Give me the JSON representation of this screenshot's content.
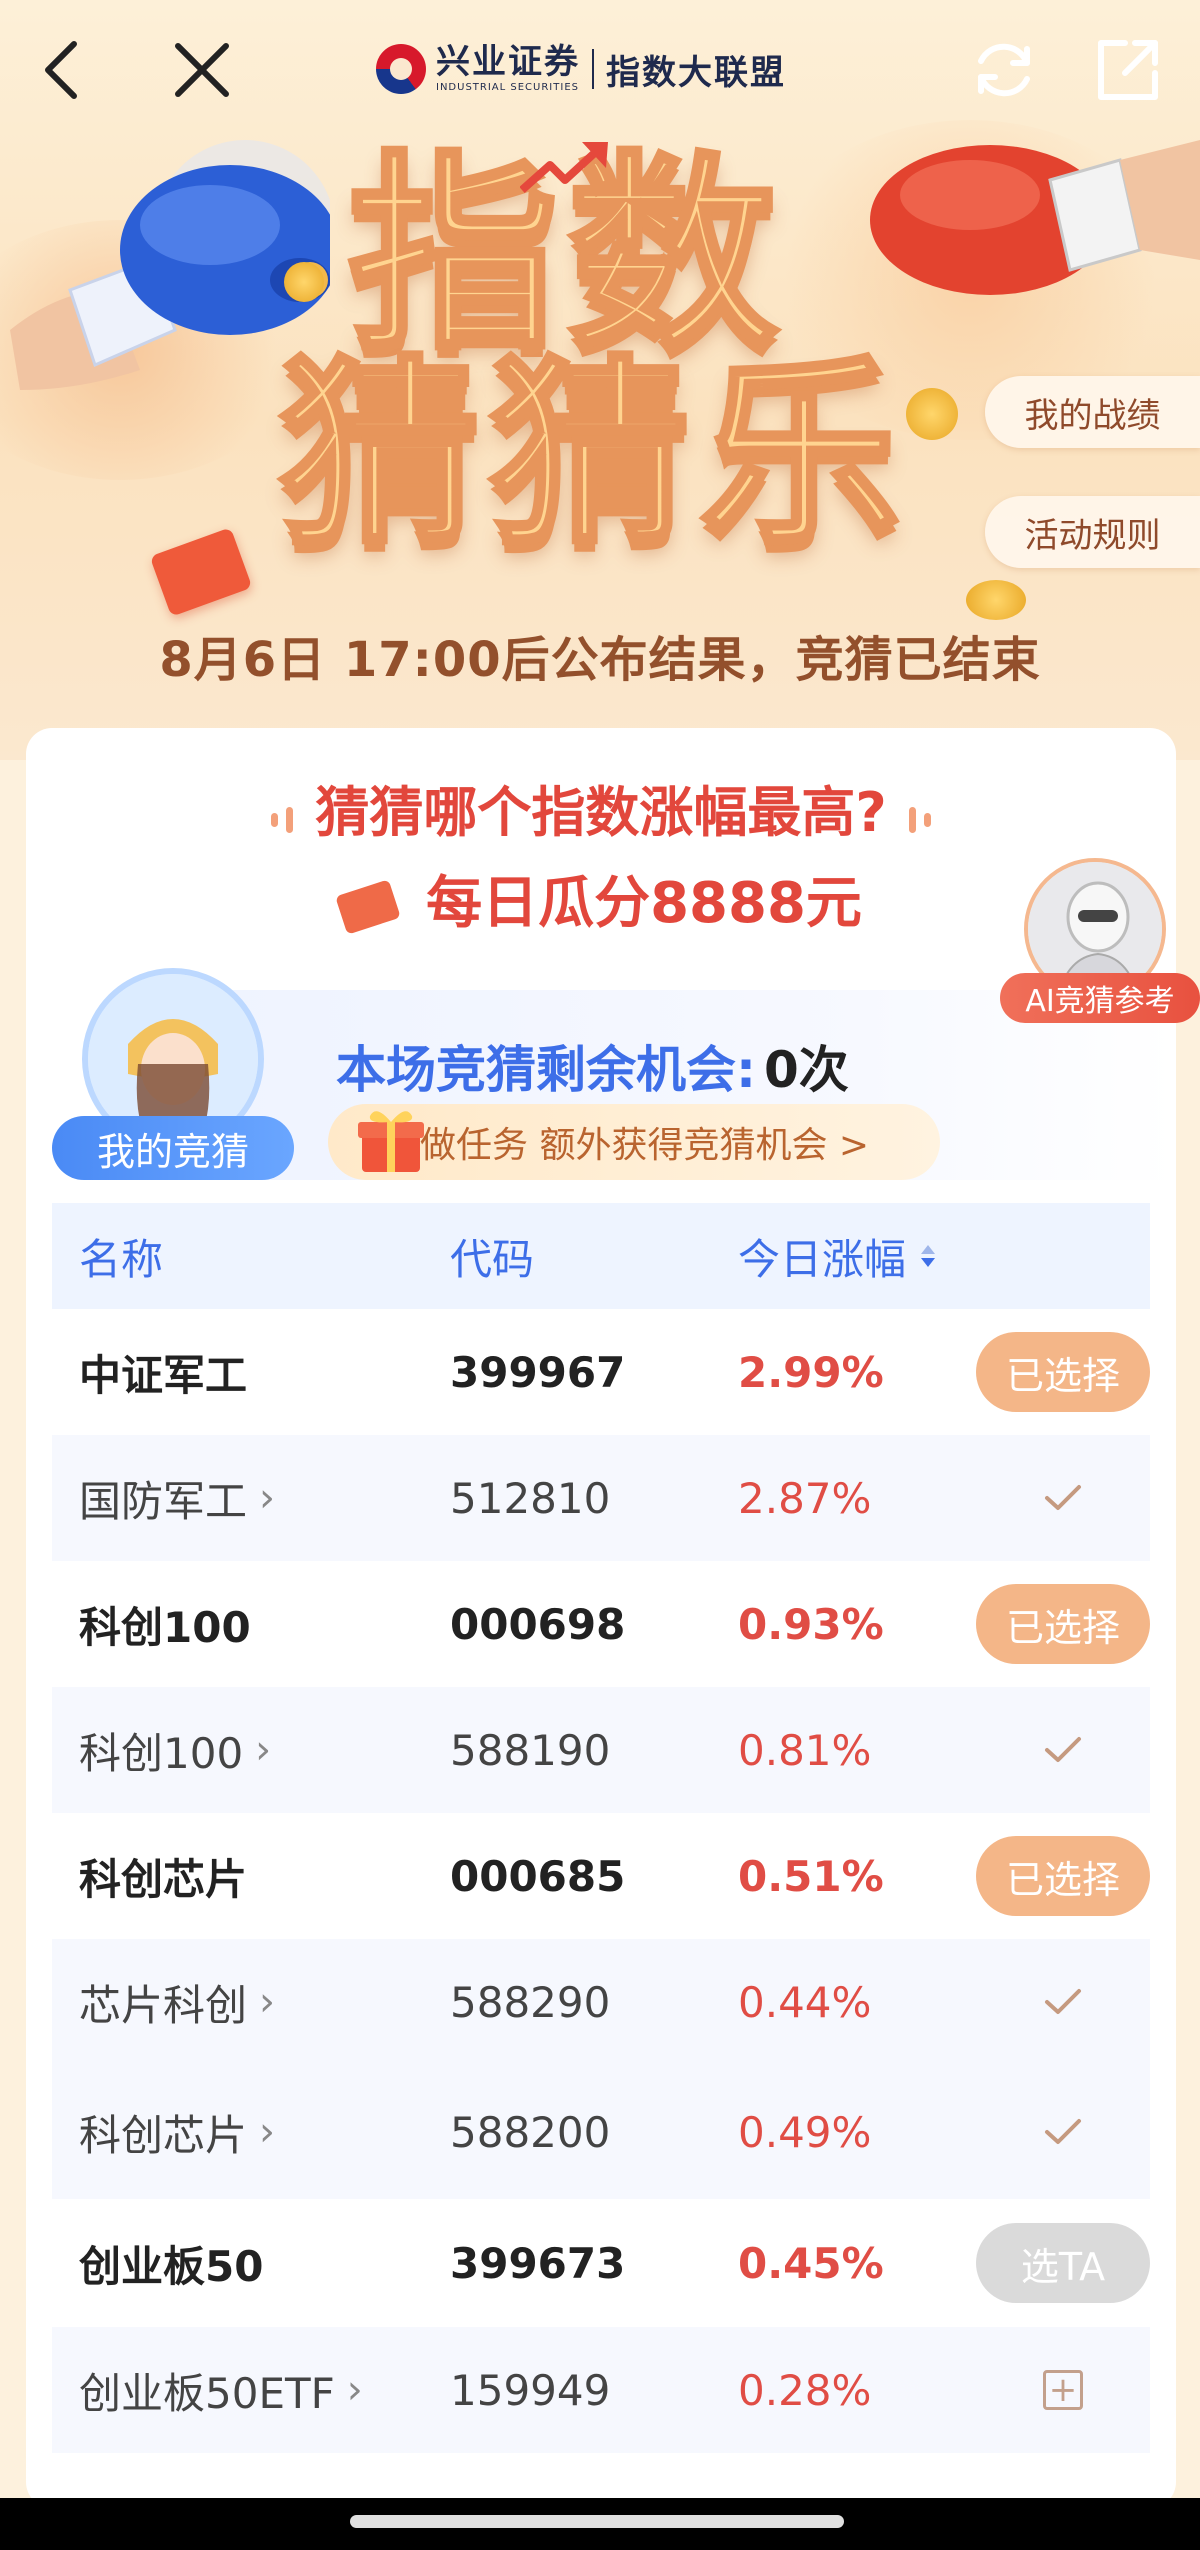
{
  "navbar": {
    "brand_cn": "兴业证券",
    "brand_en": "INDUSTRIAL SECURITIES",
    "alliance": "指数大联盟"
  },
  "hero": {
    "title_line1": "指数",
    "title_line2": "猜猜乐",
    "my_record": "我的战绩",
    "rules": "活动规则",
    "result_notice": "8月6日 17:00后公布结果，竞猜已结束"
  },
  "card": {
    "question": "猜猜哪个指数涨幅最高?",
    "prize": "每日瓜分8888元",
    "ai_label": "AI竞猜参考",
    "my_guess_label": "我的竞猜",
    "chance_label": "本场竞猜剩余机会:",
    "chance_value": "0次",
    "task_text": "做任务 额外获得竞猜机会 >"
  },
  "table": {
    "headers": {
      "name": "名称",
      "code": "代码",
      "change": "今日涨幅"
    },
    "rows": [
      {
        "name": "中证军工",
        "code": "399967",
        "change": "2.99%",
        "action": "已选择"
      },
      {
        "name": "国防军工",
        "code": "512810",
        "change": "2.87%",
        "action": "check"
      },
      {
        "name": "科创100",
        "code": "000698",
        "change": "0.93%",
        "action": "已选择"
      },
      {
        "name": "科创100",
        "code": "588190",
        "change": "0.81%",
        "action": "check"
      },
      {
        "name": "科创芯片",
        "code": "000685",
        "change": "0.51%",
        "action": "已选择"
      },
      {
        "name": "芯片科创",
        "code": "588290",
        "change": "0.44%",
        "action": "check"
      },
      {
        "name": "科创芯片",
        "code": "588200",
        "change": "0.49%",
        "action": "check"
      },
      {
        "name": "创业板50",
        "code": "399673",
        "change": "0.45%",
        "action": "选TA"
      },
      {
        "name": "创业板50ETF",
        "code": "159949",
        "change": "0.28%",
        "action": "plus"
      }
    ]
  },
  "colors": {
    "accent_red": "#e04d45",
    "accent_blue": "#3d6ee8",
    "selected_orange": "#f4b688"
  }
}
